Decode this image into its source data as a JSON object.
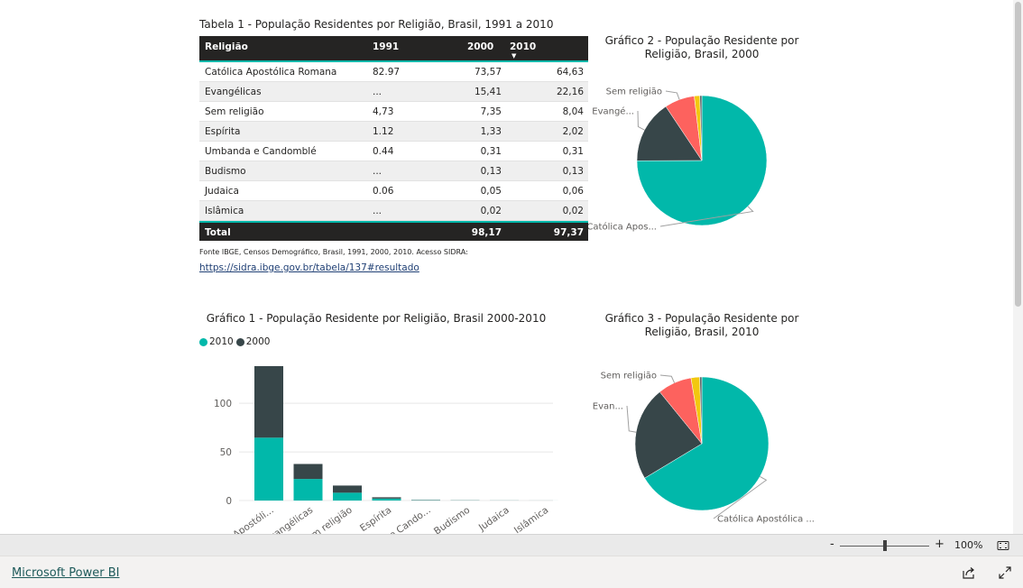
{
  "table": {
    "title": "Tabela 1 - População Residentes por Religião, Brasil, 1991 a 2010",
    "headers": [
      "Religião",
      "1991",
      "2000",
      "2010"
    ],
    "sort_indicator": "▼",
    "rows": [
      [
        "Católica Apostólica Romana",
        "82.97",
        "73,57",
        "64,63"
      ],
      [
        "Evangélicas",
        "...",
        "15,41",
        "22,16"
      ],
      [
        "Sem religião",
        "4,73",
        "7,35",
        "8,04"
      ],
      [
        "Espírita",
        "1.12",
        "1,33",
        "2,02"
      ],
      [
        "Umbanda e Candomblé",
        "0.44",
        "0,31",
        "0,31"
      ],
      [
        "Budismo",
        "...",
        "0,13",
        "0,13"
      ],
      [
        "Judaica",
        "0.06",
        "0,05",
        "0,06"
      ],
      [
        "Islâmica",
        "...",
        "0,02",
        "0,02"
      ]
    ],
    "total": [
      "Total",
      "",
      "98,17",
      "97,37"
    ],
    "source": "Fonte IBGE, Censos Demográfico, Brasil, 1991, 2000, 2010. Acesso SIDRA:",
    "source_link": "https://sidra.ibge.gov.br/tabela/137#resultado"
  },
  "colors": {
    "teal": "#01b8aa",
    "dark": "#374649",
    "red": "#fd625e",
    "yellow": "#f2c80f"
  },
  "chart_data": [
    {
      "type": "bar",
      "stacked": true,
      "title": "Gráfico 1 - População Residente por Religião, Brasil 2000-2010",
      "categories": [
        "Católica Apostólica Romana",
        "Evangélicas",
        "Sem religião",
        "Espírita",
        "Umbanda e Candomblé",
        "Budismo",
        "Judaica",
        "Islâmica"
      ],
      "tick_labels": [
        "a Apostóli...",
        "Evangélicas",
        "Sem religião",
        "Espírita",
        "a e Cando...",
        "Budismo",
        "Judaica",
        "Islâmica"
      ],
      "series": [
        {
          "name": "2010",
          "color": "#01b8aa",
          "values": [
            64.63,
            22.16,
            8.04,
            2.02,
            0.31,
            0.13,
            0.06,
            0.02
          ]
        },
        {
          "name": "2000",
          "color": "#374649",
          "values": [
            73.57,
            15.41,
            7.35,
            1.33,
            0.31,
            0.13,
            0.05,
            0.02
          ]
        }
      ],
      "yticks": [
        0,
        50,
        100
      ],
      "ylim": [
        0,
        140
      ],
      "grid": true,
      "legend": "top-left"
    },
    {
      "type": "pie",
      "title": "Gráfico 2 - População Residente por Religião, Brasil, 2000",
      "slices": [
        {
          "label": "Católica Apos...",
          "value": 73.57,
          "color": "#01b8aa"
        },
        {
          "label": "Evangé...",
          "value": 15.41,
          "color": "#374649"
        },
        {
          "label": "Sem religião",
          "value": 7.35,
          "color": "#fd625e"
        },
        {
          "label": "",
          "value": 1.33,
          "color": "#f2c80f"
        },
        {
          "label": "",
          "value": 0.51,
          "color": "#5f6b6d"
        }
      ]
    },
    {
      "type": "pie",
      "title": "Gráfico 3 - População Residente por Religião, Brasil, 2010",
      "slices": [
        {
          "label": "Católica Apostólica ...",
          "value": 64.63,
          "color": "#01b8aa"
        },
        {
          "label": "Evan...",
          "value": 22.16,
          "color": "#374649"
        },
        {
          "label": "Sem religião",
          "value": 8.04,
          "color": "#fd625e"
        },
        {
          "label": "",
          "value": 2.02,
          "color": "#f2c80f"
        },
        {
          "label": "",
          "value": 0.52,
          "color": "#5f6b6d"
        }
      ]
    }
  ],
  "zoom": {
    "minus": "-",
    "plus": "+",
    "level": "100%",
    "fraction": 0.5
  },
  "footer": {
    "brand": "Microsoft Power BI"
  }
}
